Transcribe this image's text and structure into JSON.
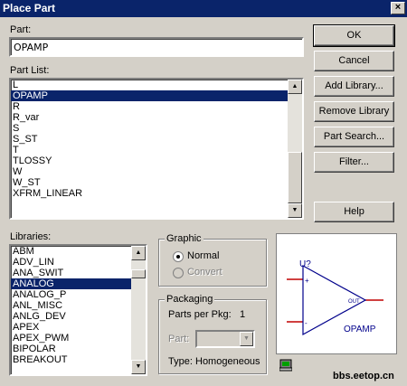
{
  "window": {
    "title": "Place Part",
    "close_glyph": "×"
  },
  "part": {
    "label": "Part:",
    "value": "OPAMP"
  },
  "part_list": {
    "label": "Part List:",
    "items": [
      "L",
      "OPAMP",
      "R",
      "R_var",
      "S",
      "S_ST",
      "T",
      "TLOSSY",
      "W",
      "W_ST",
      "XFRM_LINEAR"
    ],
    "selected": "OPAMP"
  },
  "libraries": {
    "label": "Libraries:",
    "items": [
      "ABM",
      "ADV_LIN",
      "ANA_SWIT",
      "ANALOG",
      "ANALOG_P",
      "ANL_MISC",
      "ANLG_DEV",
      "APEX",
      "APEX_PWM",
      "BIPOLAR",
      "BREAKOUT"
    ],
    "selected": "ANALOG"
  },
  "buttons": {
    "ok": "OK",
    "cancel": "Cancel",
    "add_library": "Add Library...",
    "remove_library": "Remove Library",
    "part_search": "Part Search...",
    "filter": "Filter...",
    "help": "Help"
  },
  "graphic": {
    "title": "Graphic",
    "normal": "Normal",
    "convert": "Convert"
  },
  "packaging": {
    "title": "Packaging",
    "parts_per_pkg_label": "Parts per Pkg:",
    "parts_per_pkg_value": "1",
    "part_label": "Part:",
    "type_label": "Type:",
    "type_value": "Homogeneous"
  },
  "preview": {
    "ref": "U?",
    "name": "OPAMP",
    "plus": "+",
    "minus": "-",
    "out": "OUT",
    "pin_color": "#c00000",
    "body_color": "#00008b"
  },
  "watermark": "bbs.eetop.cn",
  "colors": {
    "selection": "#0a246a",
    "titlebar": "#0a246a"
  }
}
